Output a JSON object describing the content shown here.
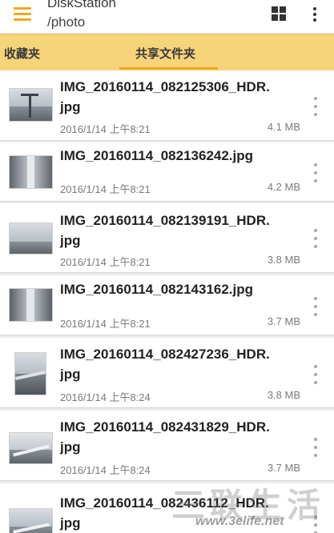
{
  "header": {
    "title": "DiskStation",
    "subtitle": "/photo",
    "menu_icon": "hamburger-icon",
    "view_icon": "grid-view-icon",
    "more_icon": "more-vert-icon"
  },
  "tabs": [
    {
      "label": "收藏夹",
      "active": false
    },
    {
      "label": "共享文件夹",
      "active": true
    }
  ],
  "colors": {
    "accent": "#f0a81c",
    "tab_bar": "#f7d37a"
  },
  "files": [
    {
      "name_line1": "IMG_20160114_082125306_HDR.",
      "name_line2": "jpg",
      "date": "2016/1/14 上午8:21",
      "size": "4.1 MB"
    },
    {
      "name_line1": "IMG_20160114_082136242.jpg",
      "name_line2": "",
      "date": "2016/1/14 上午8:21",
      "size": "4.2 MB"
    },
    {
      "name_line1": "IMG_20160114_082139191_HDR.",
      "name_line2": "jpg",
      "date": "2016/1/14 上午8:21",
      "size": "3.8 MB"
    },
    {
      "name_line1": "IMG_20160114_082143162.jpg",
      "name_line2": "",
      "date": "2016/1/14 上午8:21",
      "size": "3.7 MB"
    },
    {
      "name_line1": "IMG_20160114_082427236_HDR.",
      "name_line2": "jpg",
      "date": "2016/1/14 上午8:24",
      "size": "3.8 MB"
    },
    {
      "name_line1": "IMG_20160114_082431829_HDR.",
      "name_line2": "jpg",
      "date": "2016/1/14 上午8:24",
      "size": "3.7 MB"
    },
    {
      "name_line1": "IMG_20160114_082436112_HDR.",
      "name_line2": "jpg",
      "date": "",
      "size": ""
    }
  ],
  "watermark": {
    "text": "三联生活",
    "url": "www.3elife.net"
  }
}
